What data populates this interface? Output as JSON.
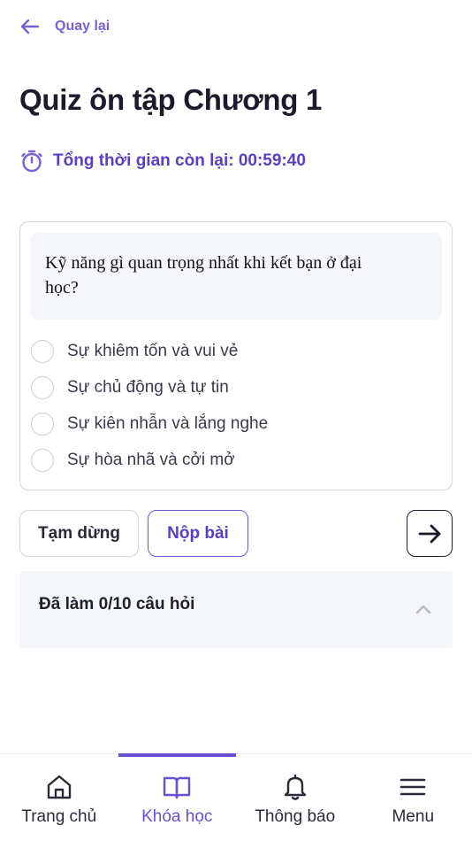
{
  "header": {
    "back_label": "Quay lại",
    "title": "Quiz ôn tập Chương 1",
    "timer_text": "Tổng thời gian còn lại: 00:59:40"
  },
  "question": {
    "text": "Kỹ năng gì quan trọng nhất khi kết bạn ở đại học?",
    "options": [
      {
        "label": "Sự khiêm tốn và vui vẻ",
        "selected": false
      },
      {
        "label": "Sự chủ động và tự tin",
        "selected": false
      },
      {
        "label": "Sự kiên nhẫn và lắng nghe",
        "selected": false
      },
      {
        "label": "Sự hòa nhã và cởi mở",
        "selected": false
      }
    ]
  },
  "actions": {
    "pause_label": "Tạm dừng",
    "submit_label": "Nộp bài"
  },
  "progress": {
    "label": "Đã làm 0/10 câu hỏi",
    "answered": 0,
    "total": 10
  },
  "nav": {
    "items": [
      {
        "label": "Trang chủ",
        "icon": "home-icon",
        "active": false
      },
      {
        "label": "Khóa học",
        "icon": "book-icon",
        "active": true
      },
      {
        "label": "Thông báo",
        "icon": "bell-icon",
        "active": false
      },
      {
        "label": "Menu",
        "icon": "menu-icon",
        "active": false
      }
    ]
  },
  "colors": {
    "accent": "#6a4fd0",
    "accent_light": "#7b61d6",
    "text": "#1f1f2e",
    "panel_bg": "#f5f6fa",
    "border": "#d4d4da"
  }
}
